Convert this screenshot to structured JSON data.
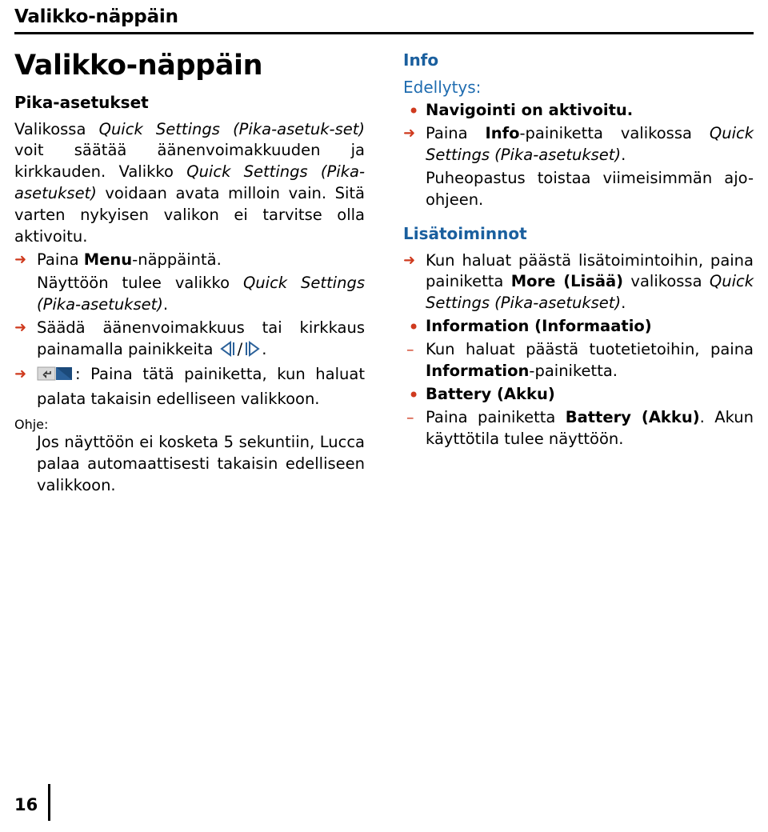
{
  "running_head": "Valikko-näppäin",
  "page_number": "16",
  "left_column": {
    "chapter_title": "Valikko-näppäin",
    "section_title": "Pika-asetukset",
    "intro_parts": [
      "Valikossa ",
      "Quick Settings (Pika-asetuk-",
      "set)",
      " voit säätää äänenvoimakkuuden ja kirkkauden. Valikko ",
      "Quick Settings (Pika-asetukset)",
      " voidaan avata milloin vain. Sitä varten nykyisen valikon ei tarvitse olla aktivoitu."
    ],
    "steps": [
      {
        "marker": "➜",
        "text_parts": [
          "Paina ",
          "Menu",
          "-näppäintä."
        ]
      },
      {
        "marker": "",
        "text_parts": [
          "Näyttöön tulee valikko ",
          "Quick Settings (Pika-asetukset)",
          "."
        ]
      },
      {
        "marker": "➜",
        "text_parts": [
          "Säädä äänenvoimakkuus tai kirkkaus painamalla painikkeita ",
          "left-arrow-key",
          " / ",
          "right-arrow-key",
          "."
        ]
      },
      {
        "marker": "➜",
        "text_parts": [
          "back-key",
          ": Paina tätä painiketta, kun haluat palata takaisin edelliseen valikkoon."
        ]
      }
    ],
    "ohje_label": "Ohje:",
    "ohje_text": "Jos näyttöön ei kosketa 5 sekuntiin, Lucca palaa automaattisesti takaisin edelliseen valikkoon."
  },
  "right_column": {
    "info_title": "Info",
    "edellytys_label": "Edellytys:",
    "edellytys_item": "Navigointi on aktivoitu.",
    "info_step_parts": [
      "Paina ",
      "Info",
      "-painiketta valikossa ",
      "Quick Settings (Pika-asetukset)",
      "."
    ],
    "info_note": "Puheopastus toistaa viimeisimmän ajo-ohjeen.",
    "lisatoiminnot_title": "Lisätoiminnot",
    "lisatoiminnot_step_parts": [
      "Kun haluat päästä lisätoimintoihin, paina painiketta ",
      "More (Lisää)",
      " valikossa ",
      "Quick Settings (Pika-asetukset)",
      "."
    ],
    "items": [
      {
        "title": "Information (Informaatio)",
        "detail_parts": [
          "Kun haluat päästä tuotetietoihin, paina ",
          "Information",
          "-painiketta."
        ]
      },
      {
        "title": "Battery (Akku)",
        "detail_parts": [
          "Paina painiketta ",
          "Battery (Akku)",
          ". Akun käyttötila tulee näyttöön."
        ]
      }
    ]
  },
  "colors": {
    "heading_blue": "#1f6cb0",
    "marker_red": "#cf3a1e",
    "rule_black": "#000000",
    "key_icon_blue": "#2a6099"
  }
}
